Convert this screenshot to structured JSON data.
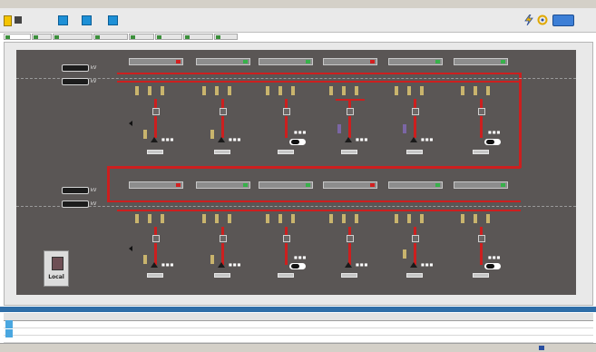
{
  "window": {
    "title": ""
  },
  "toolbar": {
    "label_1": "",
    "label_2": "",
    "label_3": ""
  },
  "tabs": [
    {
      "label": ""
    },
    {
      "label": ""
    },
    {
      "label": ""
    },
    {
      "label": ""
    },
    {
      "label": ""
    },
    {
      "label": ""
    },
    {
      "label": ""
    },
    {
      "label": ""
    },
    {
      "label": ""
    }
  ],
  "meters": [
    {
      "value": "",
      "unit": "kV"
    },
    {
      "value": "",
      "unit": "kV"
    },
    {
      "value": "",
      "unit": "kV"
    },
    {
      "value": "",
      "unit": "kV"
    }
  ],
  "top_bays": [
    {
      "label": ""
    },
    {
      "label": ""
    },
    {
      "label": ""
    },
    {
      "label": ""
    },
    {
      "label": ""
    },
    {
      "label": ""
    }
  ],
  "bottom_bays": [
    {
      "label": ""
    },
    {
      "label": ""
    },
    {
      "label": ""
    },
    {
      "label": ""
    },
    {
      "label": ""
    },
    {
      "label": ""
    }
  ],
  "local_button": {
    "label": "Local"
  },
  "event_log": {
    "title": "",
    "headers": [
      "",
      "",
      "",
      "",
      "",
      "",
      "",
      "",
      "",
      "",
      ""
    ],
    "rows": [
      [
        "",
        "",
        "",
        "",
        "",
        "",
        ""
      ],
      [
        "",
        "",
        "",
        "",
        "",
        "",
        ""
      ],
      [
        "",
        "",
        "",
        "",
        "",
        "",
        ""
      ]
    ]
  },
  "statusbar": {
    "left": "",
    "right": ""
  },
  "colors": {
    "busbar": "#cc1f1f",
    "panel": "#5a5655",
    "accent": "#1e90d6"
  }
}
